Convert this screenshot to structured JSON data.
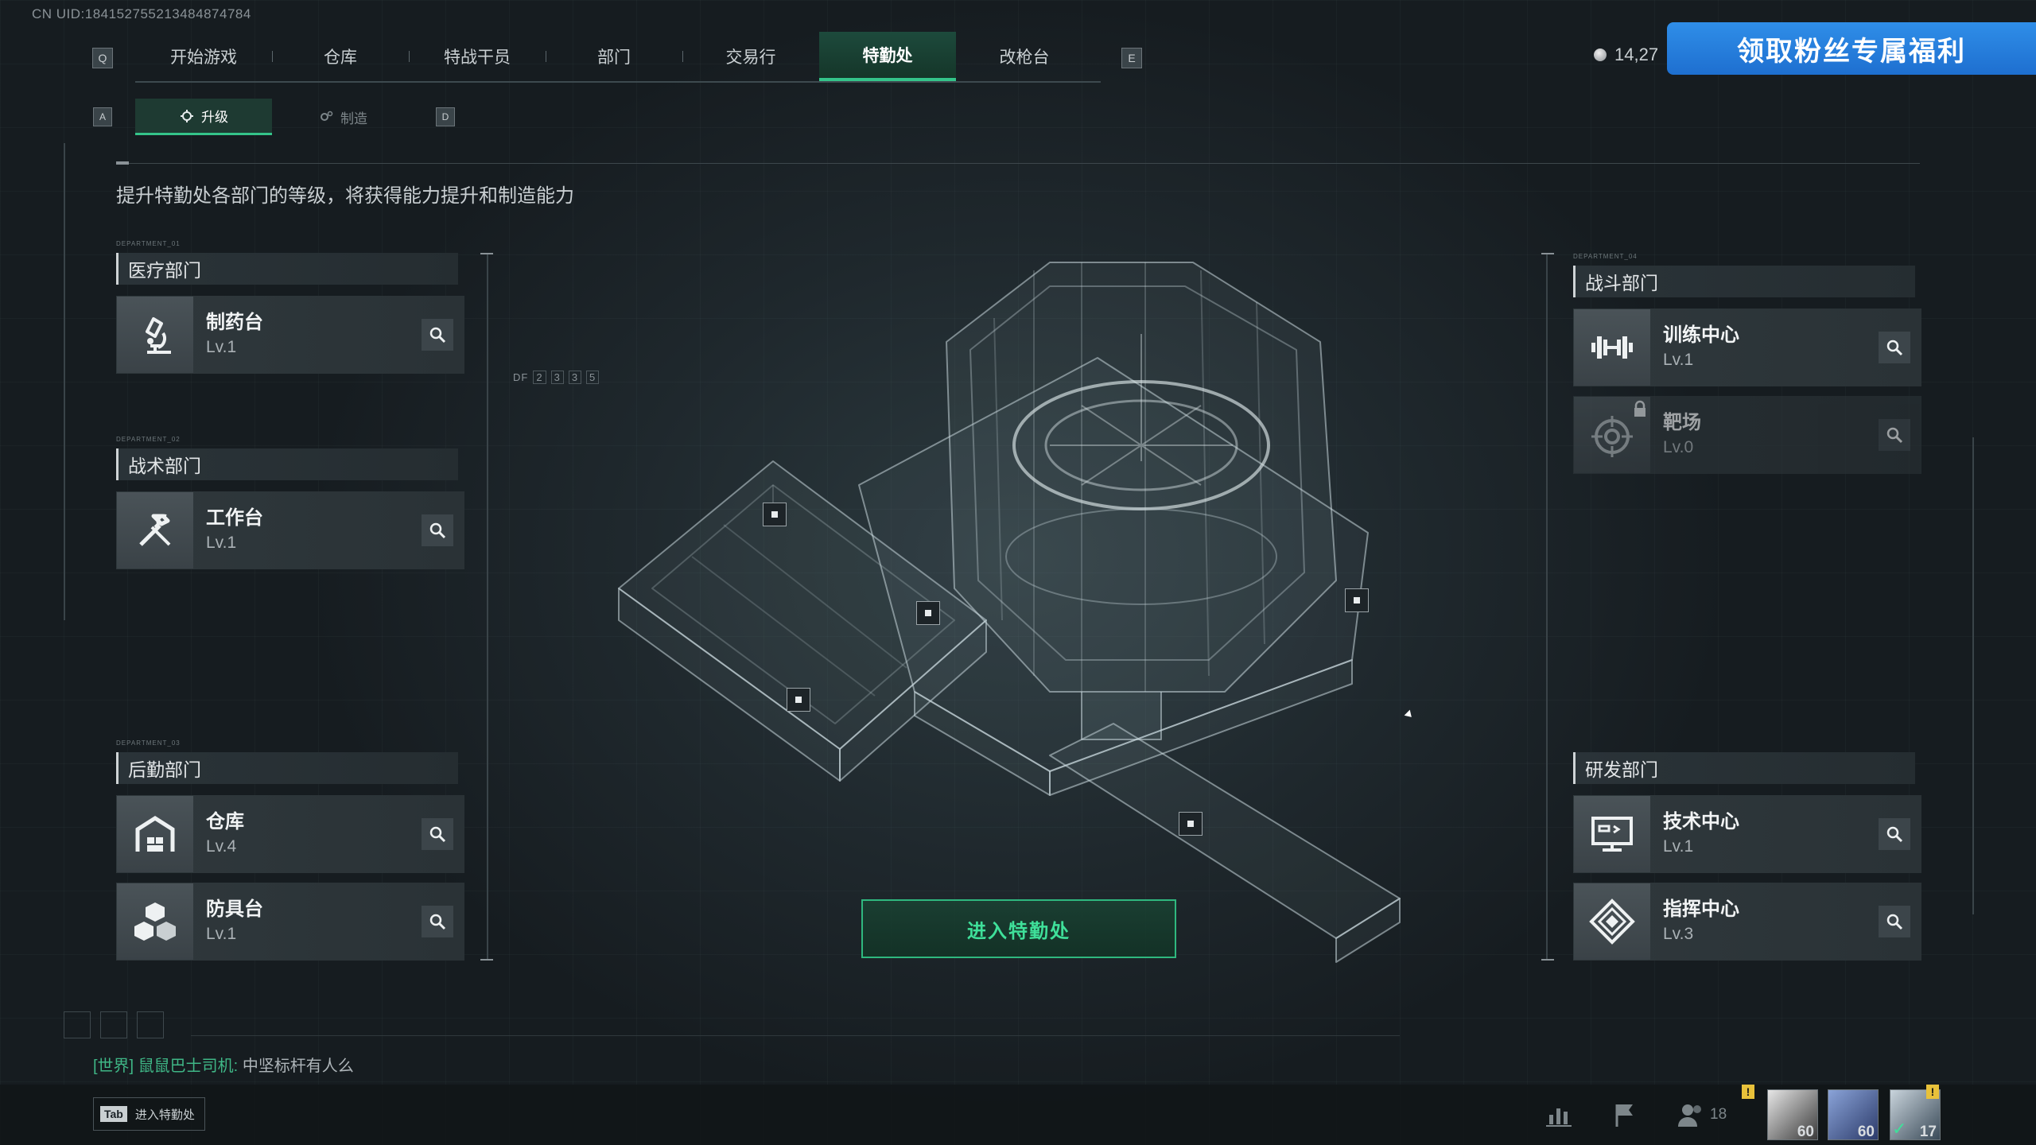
{
  "uid": "CN UID:184152755213484874784",
  "top_nav": {
    "left_key": "Q",
    "right_key": "E",
    "tabs": [
      {
        "label": "开始游戏"
      },
      {
        "label": "仓库"
      },
      {
        "label": "特战干员"
      },
      {
        "label": "部门"
      },
      {
        "label": "交易行"
      },
      {
        "label": "特勤处",
        "active": true
      },
      {
        "label": "改枪台"
      }
    ]
  },
  "currency": {
    "value": "14,27"
  },
  "promo": {
    "label": "领取粉丝专属福利"
  },
  "sub_tabs": {
    "left_key": "A",
    "right_key": "D",
    "upgrade_label": "升级",
    "craft_label": "制造"
  },
  "description": "提升特勤处各部门的等级，将获得能力提升和制造能力",
  "departments": {
    "medical": {
      "tag": "DEPARTMENT_01",
      "title": "医疗部门",
      "facilities": [
        {
          "name": "制药台",
          "level": "Lv.1"
        }
      ]
    },
    "tactical": {
      "tag": "DEPARTMENT_02",
      "title": "战术部门",
      "facilities": [
        {
          "name": "工作台",
          "level": "Lv.1"
        }
      ]
    },
    "logistics": {
      "tag": "DEPARTMENT_03",
      "title": "后勤部门",
      "facilities": [
        {
          "name": "仓库",
          "level": "Lv.4"
        },
        {
          "name": "防具台",
          "level": "Lv.1"
        }
      ]
    },
    "combat": {
      "tag": "DEPARTMENT_04",
      "title": "战斗部门",
      "facilities": [
        {
          "name": "训练中心",
          "level": "Lv.1"
        },
        {
          "name": "靶场",
          "level": "Lv.0",
          "locked": true
        }
      ]
    },
    "research": {
      "title": "研发部门",
      "facilities": [
        {
          "name": "技术中心",
          "level": "Lv.1"
        },
        {
          "name": "指挥中心",
          "level": "Lv.3"
        }
      ]
    }
  },
  "center": {
    "enter_button": "进入特勤处",
    "df_label": "DF",
    "df_digits": [
      "2",
      "3",
      "3",
      "5"
    ]
  },
  "chat": {
    "channel": "[世界]",
    "sender": "鼠鼠巴士司机:",
    "message": "中坚标杆有人么"
  },
  "bottom": {
    "tab_key": "Tab",
    "tab_hint": "进入特勤处",
    "friends_count": "18",
    "avatars": [
      {
        "level": "60"
      },
      {
        "level": "60"
      },
      {
        "level": "17"
      }
    ]
  },
  "colors": {
    "accent_green": "#34c48a",
    "promo_blue": "#2f8ee8",
    "warning_yellow": "#e8c13a"
  }
}
